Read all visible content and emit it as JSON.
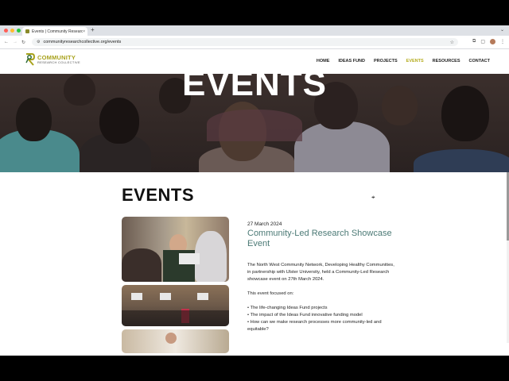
{
  "browser": {
    "tab_title": "Events | Community Research",
    "tab_close": "×",
    "new_tab": "+",
    "url": "communityresearchcollective.org/events",
    "win_ctl": "⌄"
  },
  "site": {
    "logo_line1": "COMMUNITY",
    "logo_line2": "RESEARCH COLLECTIVE",
    "nav": [
      "HOME",
      "IDEAS FUND",
      "PROJECTS",
      "EVENTS",
      "RESOURCES",
      "CONTACT"
    ],
    "active_nav": "EVENTS"
  },
  "hero": {
    "title": "EVENTS"
  },
  "content": {
    "heading": "EVENTS",
    "event": {
      "date": "27 March 2024",
      "title": "Community-Led Research Showcase Event",
      "intro": "The North West Community Network, Developing Healthy Communities, in partnership with Ulster University, held a Community-Led Research showcase event on 27th March 2024.",
      "focus_label": "This event focused on:",
      "bullets": [
        "• The life-changing Ideas Fund projects",
        "• The impact of the Ideas Fund innovative funding model",
        "• How can we make research processes more community-led and equitable?"
      ]
    }
  },
  "colors": {
    "accent": "#b4ab1e",
    "title_teal": "#4c7a76"
  },
  "icons": [
    "back-icon",
    "forward-icon",
    "reload-icon",
    "site-info-icon",
    "bookmark-star-icon",
    "extension-icon",
    "profile-avatar"
  ]
}
